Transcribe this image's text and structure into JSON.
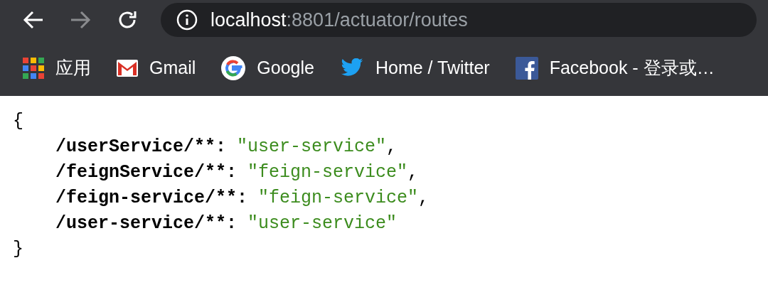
{
  "toolbar": {
    "back": {
      "disabled": false
    },
    "forward": {
      "disabled": true
    },
    "url": {
      "host": "localhost",
      "path": ":8801/actuator/routes"
    }
  },
  "bookmarks": [
    {
      "kind": "apps",
      "label": "应用"
    },
    {
      "kind": "gmail",
      "label": "Gmail"
    },
    {
      "kind": "google",
      "label": "Google"
    },
    {
      "kind": "twitter",
      "label": "Home / Twitter"
    },
    {
      "kind": "facebook",
      "label": "Facebook - 登录或…"
    }
  ],
  "json_view": {
    "open": "{",
    "close": "}",
    "entries": [
      {
        "key": "/userService/**:",
        "value": "\"user-service\"",
        "comma": ","
      },
      {
        "key": "/feignService/**:",
        "value": "\"feign-service\"",
        "comma": ","
      },
      {
        "key": "/feign-service/**:",
        "value": "\"feign-service\"",
        "comma": ","
      },
      {
        "key": "/user-service/**:",
        "value": "\"user-service\""
      }
    ]
  }
}
